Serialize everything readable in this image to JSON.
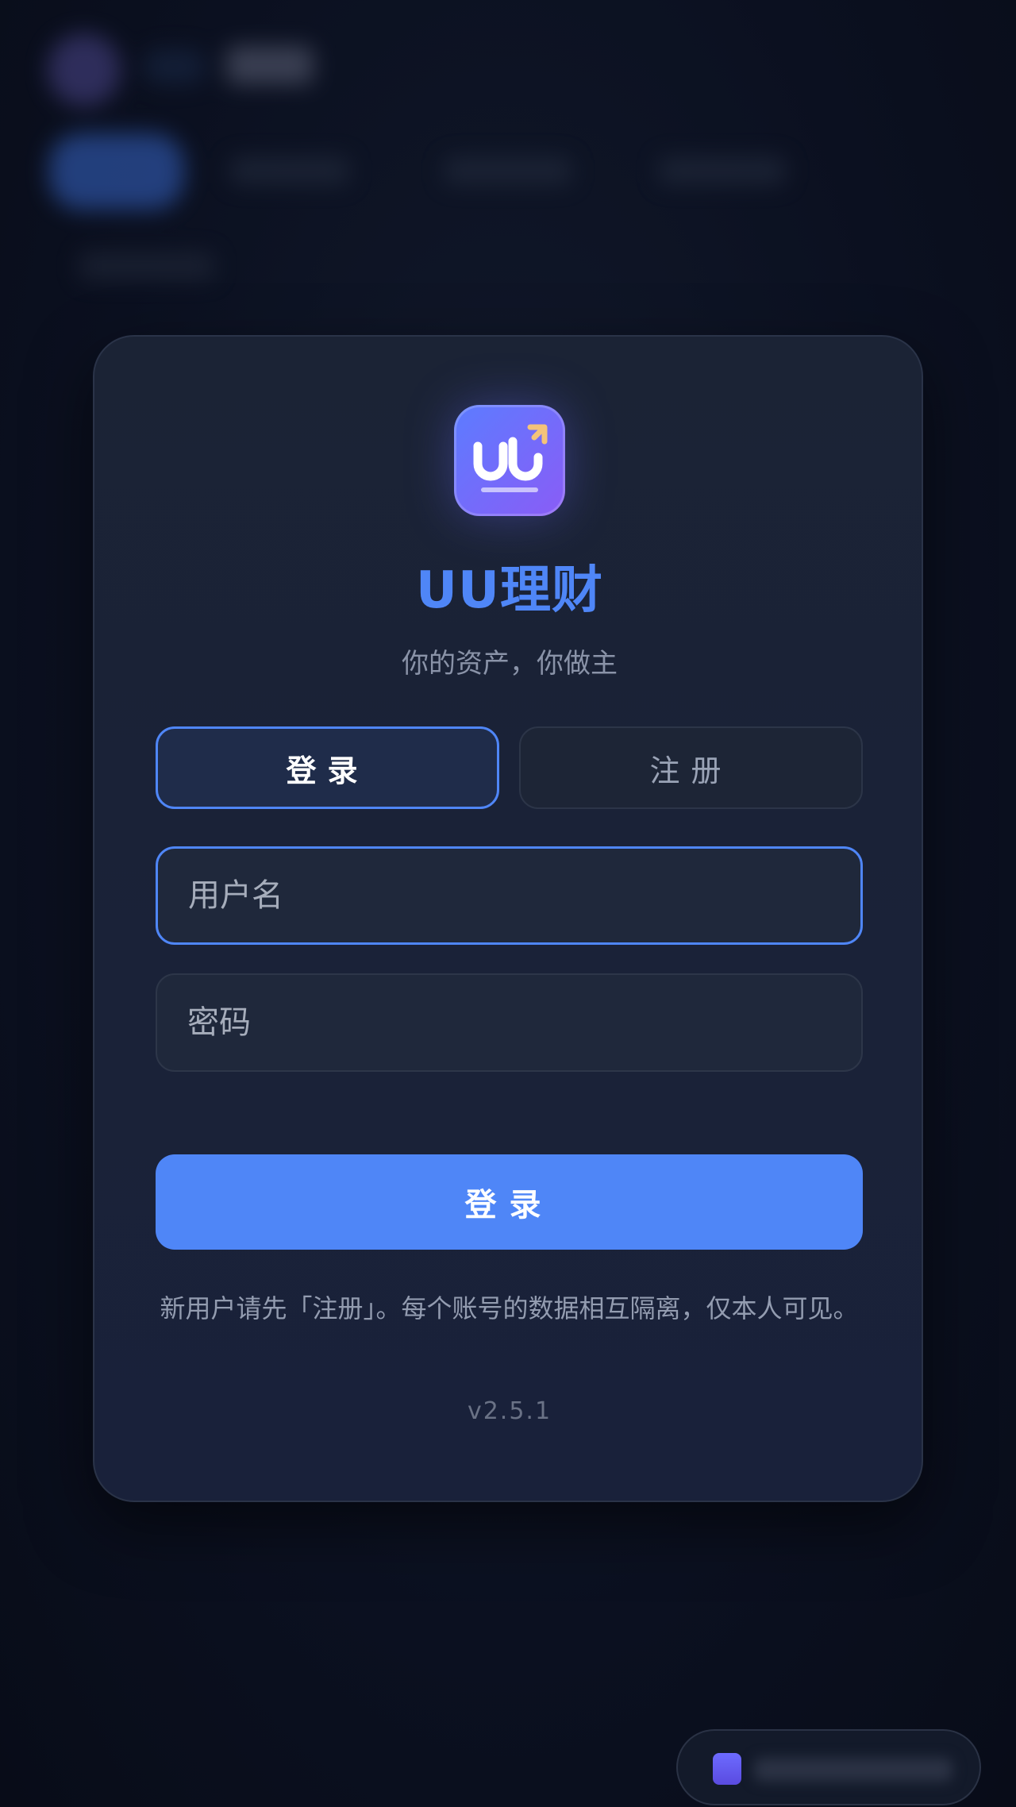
{
  "app": {
    "title": "UU理财",
    "tagline": "你的资产，你做主",
    "version": "v2.5.1"
  },
  "tabs": {
    "login_label": "登录",
    "register_label": "注册",
    "active": "login"
  },
  "form": {
    "username_placeholder": "用户名",
    "password_placeholder": "密码",
    "username_value": "",
    "password_value": "",
    "submit_label": "登录"
  },
  "hint": "新用户请先「注册」。每个账号的数据相互隔离，仅本人可见。",
  "icons": {
    "logo": "uu-logo-icon",
    "float": "app-icon"
  },
  "colors": {
    "accent": "#4f86f7",
    "card_bg": "#1b2335",
    "page_bg": "#0b1020"
  }
}
